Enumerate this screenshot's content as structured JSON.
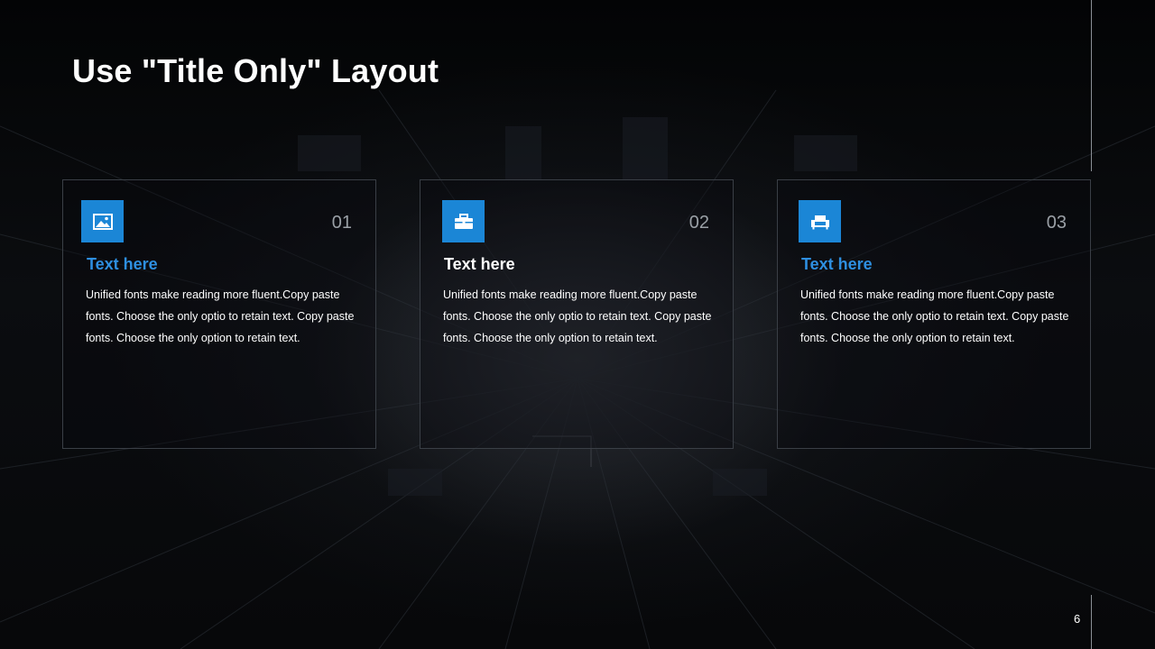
{
  "slide": {
    "title": "Use \"Title Only\" Layout",
    "page_number": "6"
  },
  "cards": [
    {
      "number": "01",
      "title": "Text here",
      "title_color": "#2e8fe0",
      "icon": "image-icon",
      "text": "Unified  fonts make reading more fluent.Copy paste fonts. Choose the only optio to retain text. Copy paste  fonts. Choose the only option to retain text."
    },
    {
      "number": "02",
      "title": "Text here",
      "title_color": "#ffffff",
      "icon": "briefcase-icon",
      "text": "Unified  fonts make reading more fluent.Copy paste fonts. Choose the only optio to retain text. Copy paste  fonts. Choose the only option to retain text."
    },
    {
      "number": "03",
      "title": "Text here",
      "title_color": "#2e8fe0",
      "icon": "armchair-icon",
      "text": "Unified  fonts make reading more fluent.Copy paste fonts. Choose the only optio to retain text. Copy paste  fonts. Choose the only option to retain text."
    }
  ],
  "colors": {
    "accent": "#1b86d6",
    "card_border": "#3a3f46",
    "background": "#050608"
  }
}
